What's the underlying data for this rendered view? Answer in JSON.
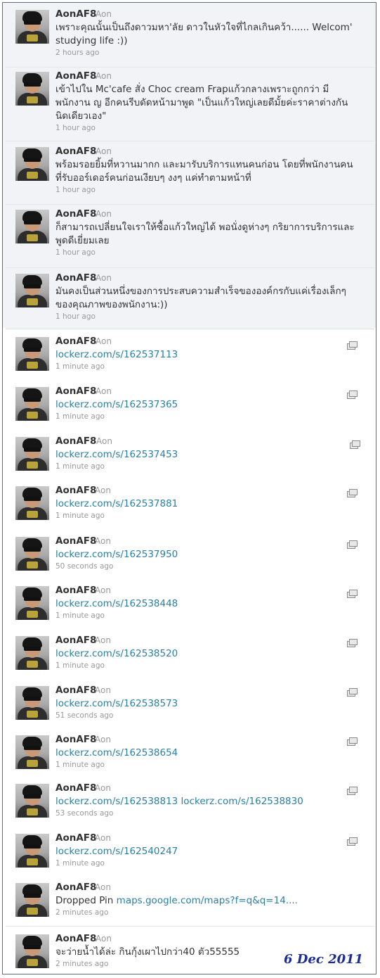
{
  "tweets": [
    {
      "name": "AonAF8",
      "handle": "Aon",
      "lines": [
        "เพราะคุณนั้นเป็นถึงดาวมหา'ลัย ดาวในหัวใจที่ไกลเกินคว้า...... Welcom'",
        "studying life :))"
      ],
      "time": "2 hours ago"
    },
    {
      "name": "AonAF8",
      "handle": "Aon",
      "lines": [
        "เข้าไปใน Mc'cafe สั่ง Choc cream Frapแก้วกลางเพราะถูกกว่า มี",
        "พนักงาน ญ อีกคนรีบดัดหน้ามาพูด \"เป็นแก้วใหญ่เลยดีมั้ยค่ะราคาต่างกัน",
        "นิดเดียวเอง\""
      ],
      "time": "1 hour ago"
    },
    {
      "name": "AonAF8",
      "handle": "Aon",
      "lines": [
        "พร้อมรอยยิ้มที่หวานมากก และมารับบริการแทนคนก่อน โดยที่พนักงานคน",
        "ที่รับออร์เดอร์คนก่อนเงียบๆ งงๆ แค่ทำตามหน้าที่"
      ],
      "time": "1 hour ago"
    },
    {
      "name": "AonAF8",
      "handle": "Aon",
      "lines": [
        "ก็สามารถเปลี่ยนใจเราให้ซื้อแก้วใหญ่ได้ พอนั่งดูห่างๆ กริยาการบริการและ",
        "พูดดีเยี่ยมเลย"
      ],
      "time": "1 hour ago"
    },
    {
      "name": "AonAF8",
      "handle": "Aon",
      "lines": [
        "มันคงเป็นส่วนหนึ่งของการประสบความสำเร็จขององค์กรกับแค่เรื่องเล็กๆ",
        "ของคุณภาพของพนักงาน:))"
      ],
      "time": "1 hour ago"
    },
    {
      "name": "AonAF8",
      "handle": "Aon",
      "link": "lockerz.com/s/162537113",
      "time": "1 minute ago"
    },
    {
      "name": "AonAF8",
      "handle": "Aon",
      "link": "lockerz.com/s/162537365",
      "time": "1 minute ago"
    },
    {
      "name": "AonAF8",
      "handle": "Aon",
      "link": "lockerz.com/s/162537453",
      "time": "1 minute ago"
    },
    {
      "name": "AonAF8",
      "handle": "Aon",
      "link": "lockerz.com/s/162537881",
      "time": "1 minute ago"
    },
    {
      "name": "AonAF8",
      "handle": "Aon",
      "link": "lockerz.com/s/162537950",
      "time": "50 seconds ago"
    },
    {
      "name": "AonAF8",
      "handle": "Aon",
      "link": "lockerz.com/s/162538448",
      "time": "1 minute ago"
    },
    {
      "name": "AonAF8",
      "handle": "Aon",
      "link": "lockerz.com/s/162538520",
      "time": "1 minute ago"
    },
    {
      "name": "AonAF8",
      "handle": "Aon",
      "link": "lockerz.com/s/162538573",
      "time": "51 seconds ago"
    },
    {
      "name": "AonAF8",
      "handle": "Aon",
      "link": "lockerz.com/s/162538654",
      "time": "1 minute ago"
    },
    {
      "name": "AonAF8",
      "handle": "Aon",
      "link": "lockerz.com/s/162538813 lockerz.com/s/162538830",
      "time": "53 seconds ago"
    },
    {
      "name": "AonAF8",
      "handle": "Aon",
      "link": "lockerz.com/s/162540247",
      "time": "1 minute ago"
    },
    {
      "name": "AonAF8",
      "handle": "Aon",
      "prefix": "Dropped Pin",
      "link": "maps.google.com/maps?f=q&q=14....",
      "time": "2 minutes ago"
    },
    {
      "name": "AonAF8",
      "handle": "Aon",
      "lines": [
        "จะว่ายน้ำได้ล่ะ กินกุ้งเผาไปกว่า40 ตัว55555"
      ],
      "time": "2 minutes ago"
    }
  ],
  "stamp": "6 Dec 2011",
  "colors": {
    "link": "#2a7fa5",
    "name": "#333333",
    "meta": "#999999",
    "stamp": "#1d2c98"
  },
  "icons": {
    "avatar": "user-avatar",
    "media": "media-preview-icon"
  }
}
